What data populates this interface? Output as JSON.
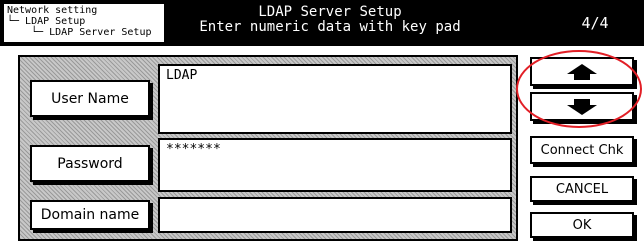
{
  "header": {
    "breadcrumb": [
      "Network setting",
      "└─ LDAP Setup",
      "    └─ LDAP Server Setup"
    ],
    "title": "LDAP Server Setup",
    "subtitle": "Enter numeric data with key pad",
    "page": "4/4"
  },
  "form": {
    "user_name_label": "User Name",
    "user_name_value": "LDAP",
    "password_label": "Password",
    "password_value": "*******",
    "domain_label": "Domain name",
    "domain_value": ""
  },
  "side": {
    "connect_label": "Connect Chk",
    "cancel_label": "CANCEL",
    "ok_label": "OK"
  },
  "colors": {
    "highlight": "#e21f26"
  }
}
